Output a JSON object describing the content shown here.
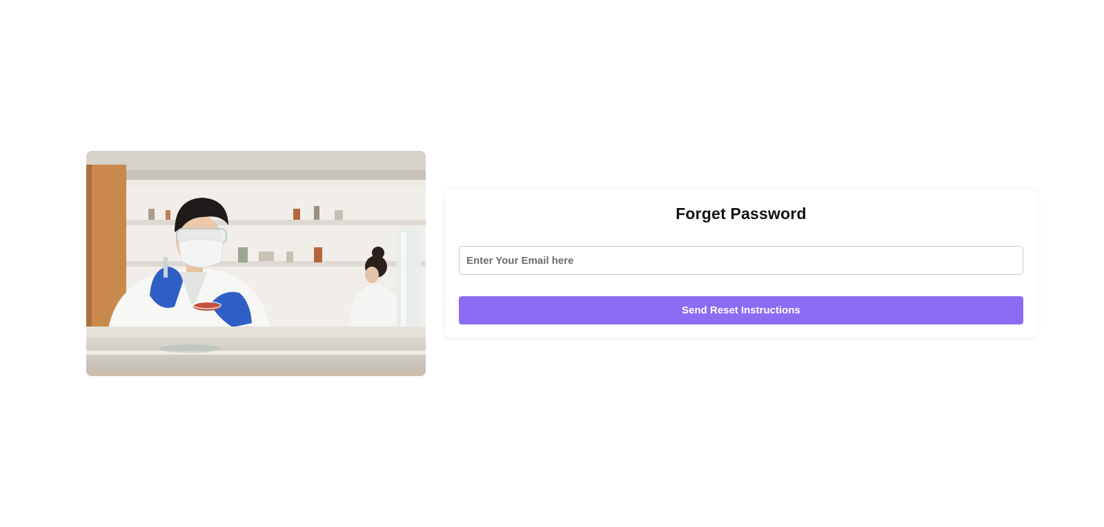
{
  "forgot_password": {
    "title": "Forget Password",
    "email_placeholder": "Enter Your Email here",
    "email_value": "",
    "submit_label": "Send Reset Instructions"
  },
  "colors": {
    "accent": "#8b6cf2",
    "background": "#ffffff",
    "title_text": "#111111"
  },
  "illustration": {
    "subject": "laboratory-scientist-photo"
  }
}
